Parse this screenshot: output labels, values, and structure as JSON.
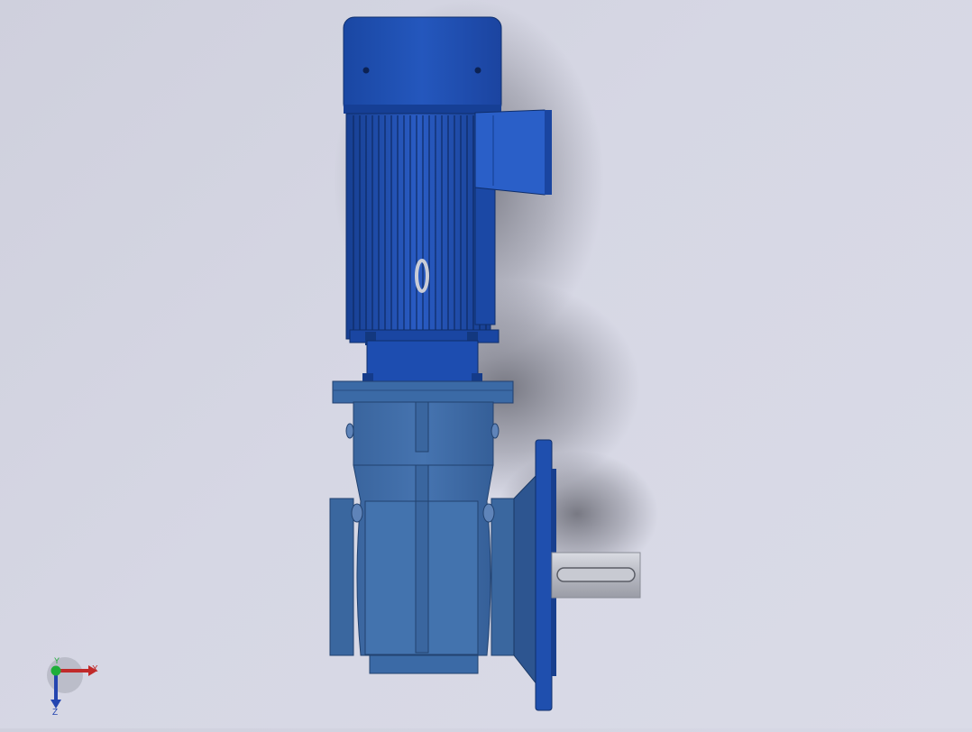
{
  "viewport": {
    "model": "gear-motor-assembly",
    "background": "#d4d5e2"
  },
  "colors": {
    "motor_blue": "#1f4fae",
    "motor_dark": "#153a86",
    "motor_light": "#3a6fd0",
    "gearbox_blue": "#3f6fa8",
    "gearbox_dark": "#2c5388",
    "shaft_grey": "#b9bbc4"
  },
  "triad": {
    "x_label": "X",
    "y_label": "Y",
    "z_label": "Z"
  }
}
